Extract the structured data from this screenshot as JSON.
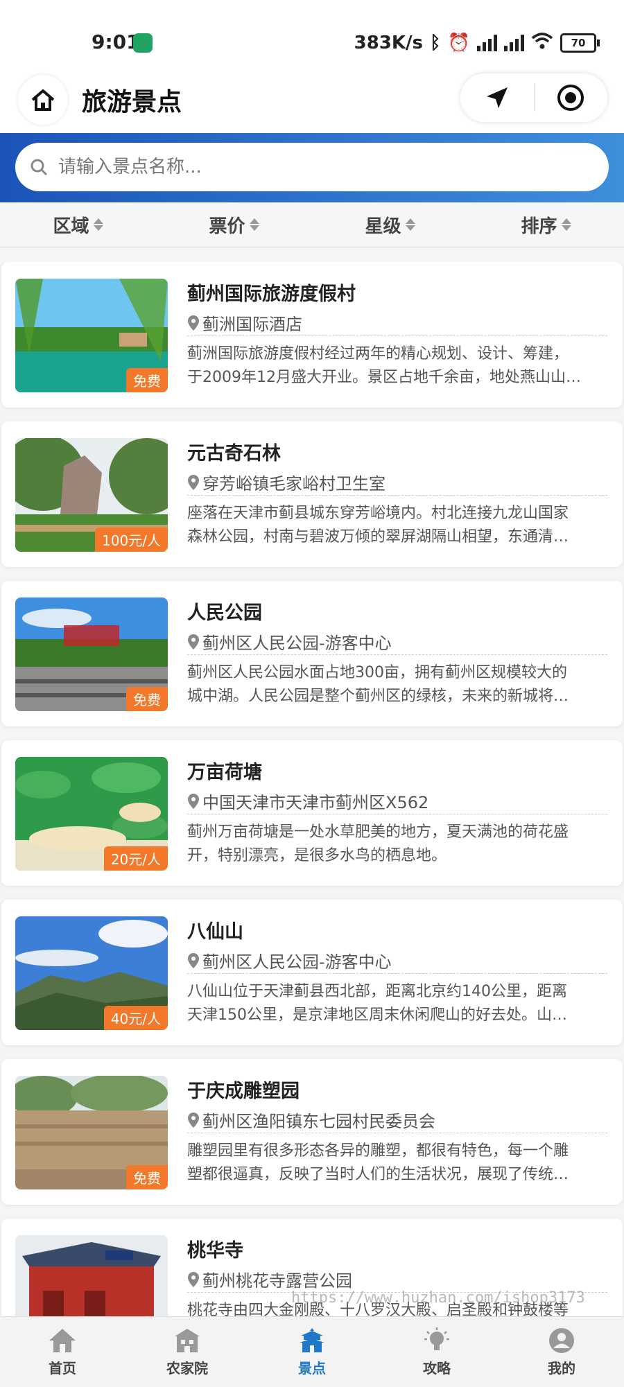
{
  "status_bar": {
    "time": "9:01",
    "speed": "383K/s",
    "battery": "70"
  },
  "header": {
    "title": "旅游景点"
  },
  "search": {
    "placeholder": "请输入景点名称..."
  },
  "filters": [
    "区域",
    "票价",
    "星级",
    "排序"
  ],
  "spots": [
    {
      "name": "蓟州国际旅游度假村",
      "location": "蓟洲国际酒店",
      "price": "免费",
      "desc1": "蓟洲国际旅游度假村经过两年的精心规划、设计、筹建，",
      "desc2": "于2009年12月盛大开业。景区占地千余亩，地处燕山山…"
    },
    {
      "name": "元古奇石林",
      "location": "穿芳峪镇毛家峪村卫生室",
      "price": "100元/人",
      "desc1": "座落在天津市蓟县城东穿芳峪境内。村北连接九龙山国家",
      "desc2": "森林公园，村南与碧波万倾的翠屏湖隔山相望，东通清…"
    },
    {
      "name": "人民公园",
      "location": "蓟州区人民公园-游客中心",
      "price": "免费",
      "desc1": "蓟州区人民公园水面占地300亩，拥有蓟州区规模较大的",
      "desc2": "城中湖。人民公园是整个蓟州区的绿核，未来的新城将…"
    },
    {
      "name": "万亩荷塘",
      "location": "中国天津市天津市蓟州区X562",
      "price": "20元/人",
      "desc1": "蓟州万亩荷塘是一处水草肥美的地方，夏天满池的荷花盛",
      "desc2": "开，特别漂亮，是很多水鸟的栖息地。"
    },
    {
      "name": "八仙山",
      "location": "蓟州区人民公园-游客中心",
      "price": "40元/人",
      "desc1": "八仙山位于天津蓟县西北部，距离北京约140公里，距离",
      "desc2": "天津150公里，是京津地区周末休闲爬山的好去处。山…"
    },
    {
      "name": "于庆成雕塑园",
      "location": "蓟州区渔阳镇东七园村民委员会",
      "price": "免费",
      "desc1": "雕塑园里有很多形态各异的雕塑，都很有特色，每一个雕",
      "desc2": "塑都很逼真，反映了当时人们的生活状况，展现了传统…"
    },
    {
      "name": "桃华寺",
      "location": "蓟州桃花寺露营公园",
      "price": "",
      "desc1": "桃花寺由四大金刚殿、十八罗汉大殿、启圣殿和钟鼓楼等",
      "desc2": ""
    }
  ],
  "watermark": "https://www.huzhan.com/ishop3173",
  "tabs": [
    {
      "label": "首页",
      "icon": "home-icon"
    },
    {
      "label": "农家院",
      "icon": "farmhouse-icon"
    },
    {
      "label": "景点",
      "icon": "temple-icon",
      "active": true
    },
    {
      "label": "攻略",
      "icon": "lightbulb-icon"
    },
    {
      "label": "我的",
      "icon": "user-icon"
    }
  ],
  "colors": {
    "accent": "#1f78c8",
    "price_tag": "#f4782a",
    "search_band": "#2a6fc9"
  }
}
